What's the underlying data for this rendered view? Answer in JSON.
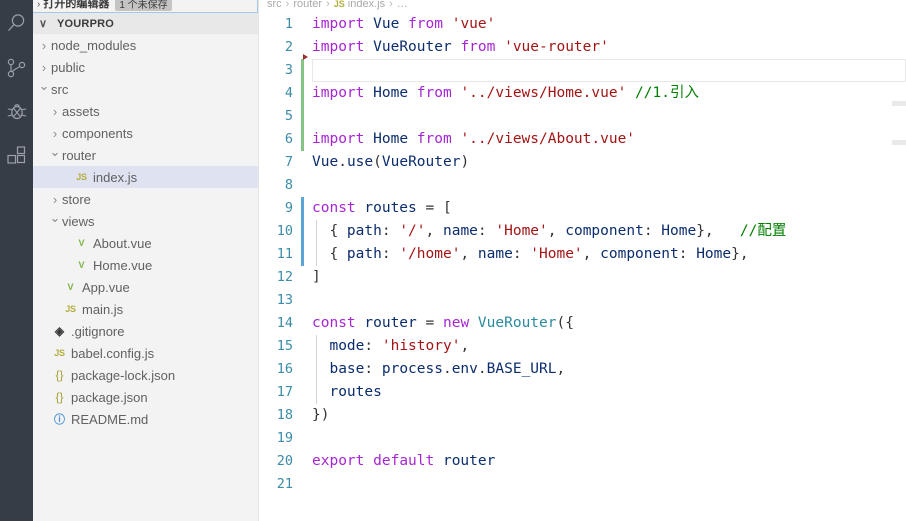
{
  "activity_bar": {
    "items": [
      {
        "name": "search-icon",
        "label": "Search"
      },
      {
        "name": "source-control-icon",
        "label": "Source Control"
      },
      {
        "name": "debug-icon",
        "label": "Run and Debug"
      },
      {
        "name": "extensions-icon",
        "label": "Extensions"
      }
    ]
  },
  "sidebar": {
    "open_editors": {
      "label": "打开的编辑器",
      "badge": "1 个未保存",
      "chevron": "›"
    },
    "folder": {
      "label": "YOURPRO",
      "chevron": "∨"
    },
    "tree": [
      {
        "label": "node_modules",
        "indent": 1,
        "type": "folder",
        "state": "collapsed",
        "icon": "chevron-right-icon",
        "selected": false
      },
      {
        "label": "public",
        "indent": 1,
        "type": "folder",
        "state": "collapsed",
        "icon": "chevron-right-icon",
        "selected": false
      },
      {
        "label": "src",
        "indent": 1,
        "type": "folder",
        "state": "expanded",
        "icon": "chevron-down-icon",
        "selected": false
      },
      {
        "label": "assets",
        "indent": 2,
        "type": "folder",
        "state": "collapsed",
        "icon": "chevron-right-icon",
        "selected": false
      },
      {
        "label": "components",
        "indent": 2,
        "type": "folder",
        "state": "collapsed",
        "icon": "chevron-right-icon",
        "selected": false
      },
      {
        "label": "router",
        "indent": 2,
        "type": "folder",
        "state": "expanded",
        "icon": "chevron-down-icon",
        "selected": false
      },
      {
        "label": "index.js",
        "indent": 3,
        "type": "file",
        "icon": "js-file-icon",
        "badge": "JS",
        "selected": true
      },
      {
        "label": "store",
        "indent": 2,
        "type": "folder",
        "state": "collapsed",
        "icon": "chevron-right-icon",
        "selected": false
      },
      {
        "label": "views",
        "indent": 2,
        "type": "folder",
        "state": "expanded",
        "icon": "chevron-down-icon",
        "selected": false
      },
      {
        "label": "About.vue",
        "indent": 3,
        "type": "file",
        "icon": "vue-file-icon",
        "badge": "V",
        "selected": false
      },
      {
        "label": "Home.vue",
        "indent": 3,
        "type": "file",
        "icon": "vue-file-icon",
        "badge": "V",
        "selected": false
      },
      {
        "label": "App.vue",
        "indent": 2,
        "type": "file",
        "icon": "vue-file-icon",
        "badge": "V",
        "selected": false
      },
      {
        "label": "main.js",
        "indent": 2,
        "type": "file",
        "icon": "js-file-icon",
        "badge": "JS",
        "selected": false
      },
      {
        "label": ".gitignore",
        "indent": 1,
        "type": "file",
        "icon": "git-file-icon",
        "badge": "◈",
        "selected": false
      },
      {
        "label": "babel.config.js",
        "indent": 1,
        "type": "file",
        "icon": "js-file-icon",
        "badge": "JS",
        "selected": false
      },
      {
        "label": "package-lock.json",
        "indent": 1,
        "type": "file",
        "icon": "json-file-icon",
        "badge": "{}",
        "selected": false
      },
      {
        "label": "package.json",
        "indent": 1,
        "type": "file",
        "icon": "json-file-icon",
        "badge": "{}",
        "selected": false
      },
      {
        "label": "README.md",
        "indent": 1,
        "type": "file",
        "icon": "markdown-file-icon",
        "badge": "ⓘ",
        "selected": false
      }
    ]
  },
  "editor": {
    "breadcrumb": [
      "src",
      "router",
      "index.js",
      "…"
    ],
    "breadcrumb_file_badge": "JS",
    "active_line": 3,
    "total_lines": 21,
    "lines": [
      {
        "n": "1",
        "gutter": "",
        "indent": 0,
        "tokens": [
          {
            "t": "import",
            "c": "kw"
          },
          {
            "t": " ",
            "c": "pl"
          },
          {
            "t": "Vue",
            "c": "id"
          },
          {
            "t": " ",
            "c": "pl"
          },
          {
            "t": "from",
            "c": "kw"
          },
          {
            "t": " ",
            "c": "pl"
          },
          {
            "t": "'vue'",
            "c": "str"
          }
        ]
      },
      {
        "n": "2",
        "gutter": "",
        "indent": 0,
        "tokens": [
          {
            "t": "import",
            "c": "kw"
          },
          {
            "t": " ",
            "c": "pl"
          },
          {
            "t": "VueRouter",
            "c": "id"
          },
          {
            "t": " ",
            "c": "pl"
          },
          {
            "t": "from",
            "c": "kw"
          },
          {
            "t": " ",
            "c": "pl"
          },
          {
            "t": "'vue-router'",
            "c": "str"
          }
        ]
      },
      {
        "n": "3",
        "gutter": "green",
        "indent": 0,
        "current": true,
        "tokens": []
      },
      {
        "n": "4",
        "gutter": "green",
        "indent": 0,
        "tokens": [
          {
            "t": "import",
            "c": "kw"
          },
          {
            "t": " ",
            "c": "pl"
          },
          {
            "t": "Home",
            "c": "id"
          },
          {
            "t": " ",
            "c": "pl"
          },
          {
            "t": "from",
            "c": "kw"
          },
          {
            "t": " ",
            "c": "pl"
          },
          {
            "t": "'../views/Home.vue'",
            "c": "str"
          },
          {
            "t": " ",
            "c": "pl"
          },
          {
            "t": "//1.引入",
            "c": "cmt"
          }
        ]
      },
      {
        "n": "5",
        "gutter": "green",
        "indent": 0,
        "tokens": []
      },
      {
        "n": "6",
        "gutter": "green",
        "indent": 0,
        "tokens": [
          {
            "t": "import",
            "c": "kw"
          },
          {
            "t": " ",
            "c": "pl"
          },
          {
            "t": "Home",
            "c": "id"
          },
          {
            "t": " ",
            "c": "pl"
          },
          {
            "t": "from",
            "c": "kw"
          },
          {
            "t": " ",
            "c": "pl"
          },
          {
            "t": "'../views/About.vue'",
            "c": "str"
          }
        ]
      },
      {
        "n": "7",
        "gutter": "",
        "indent": 0,
        "tokens": [
          {
            "t": "Vue",
            "c": "id"
          },
          {
            "t": ".",
            "c": "pl"
          },
          {
            "t": "use",
            "c": "id"
          },
          {
            "t": "(",
            "c": "pl"
          },
          {
            "t": "VueRouter",
            "c": "id"
          },
          {
            "t": ")",
            "c": "pl"
          }
        ]
      },
      {
        "n": "8",
        "gutter": "",
        "indent": 0,
        "tokens": []
      },
      {
        "n": "9",
        "gutter": "blue",
        "indent": 0,
        "tokens": [
          {
            "t": "const",
            "c": "kw"
          },
          {
            "t": " ",
            "c": "pl"
          },
          {
            "t": "routes",
            "c": "id"
          },
          {
            "t": " = [",
            "c": "pl"
          }
        ]
      },
      {
        "n": "10",
        "gutter": "blue",
        "indent": 1,
        "tokens": [
          {
            "t": "  { ",
            "c": "pl"
          },
          {
            "t": "path",
            "c": "id"
          },
          {
            "t": ": ",
            "c": "pl"
          },
          {
            "t": "'/'",
            "c": "str"
          },
          {
            "t": ", ",
            "c": "pl"
          },
          {
            "t": "name",
            "c": "id"
          },
          {
            "t": ": ",
            "c": "pl"
          },
          {
            "t": "'Home'",
            "c": "str"
          },
          {
            "t": ", ",
            "c": "pl"
          },
          {
            "t": "component",
            "c": "id"
          },
          {
            "t": ": ",
            "c": "pl"
          },
          {
            "t": "Home",
            "c": "id"
          },
          {
            "t": "},",
            "c": "pl"
          },
          {
            "t": "   ",
            "c": "pl"
          },
          {
            "t": "//配置",
            "c": "cmt"
          }
        ]
      },
      {
        "n": "11",
        "gutter": "blue",
        "indent": 1,
        "tokens": [
          {
            "t": "  { ",
            "c": "pl"
          },
          {
            "t": "path",
            "c": "id"
          },
          {
            "t": ": ",
            "c": "pl"
          },
          {
            "t": "'/home'",
            "c": "str"
          },
          {
            "t": ", ",
            "c": "pl"
          },
          {
            "t": "name",
            "c": "id"
          },
          {
            "t": ": ",
            "c": "pl"
          },
          {
            "t": "'Home'",
            "c": "str"
          },
          {
            "t": ", ",
            "c": "pl"
          },
          {
            "t": "component",
            "c": "id"
          },
          {
            "t": ": ",
            "c": "pl"
          },
          {
            "t": "Home",
            "c": "id"
          },
          {
            "t": "},",
            "c": "pl"
          }
        ]
      },
      {
        "n": "12",
        "gutter": "",
        "indent": 0,
        "tokens": [
          {
            "t": "]",
            "c": "pl"
          }
        ]
      },
      {
        "n": "13",
        "gutter": "",
        "indent": 0,
        "tokens": []
      },
      {
        "n": "14",
        "gutter": "",
        "indent": 0,
        "tokens": [
          {
            "t": "const",
            "c": "kw"
          },
          {
            "t": " ",
            "c": "pl"
          },
          {
            "t": "router",
            "c": "id"
          },
          {
            "t": " = ",
            "c": "pl"
          },
          {
            "t": "new",
            "c": "kw"
          },
          {
            "t": " ",
            "c": "pl"
          },
          {
            "t": "VueRouter",
            "c": "type"
          },
          {
            "t": "({",
            "c": "pl"
          }
        ]
      },
      {
        "n": "15",
        "gutter": "",
        "indent": 1,
        "tokens": [
          {
            "t": "  ",
            "c": "pl"
          },
          {
            "t": "mode",
            "c": "id"
          },
          {
            "t": ": ",
            "c": "pl"
          },
          {
            "t": "'history'",
            "c": "str"
          },
          {
            "t": ",",
            "c": "pl"
          }
        ]
      },
      {
        "n": "16",
        "gutter": "",
        "indent": 1,
        "tokens": [
          {
            "t": "  ",
            "c": "pl"
          },
          {
            "t": "base",
            "c": "id"
          },
          {
            "t": ": ",
            "c": "pl"
          },
          {
            "t": "process",
            "c": "id"
          },
          {
            "t": ".",
            "c": "pl"
          },
          {
            "t": "env",
            "c": "id"
          },
          {
            "t": ".",
            "c": "pl"
          },
          {
            "t": "BASE_URL",
            "c": "id"
          },
          {
            "t": ",",
            "c": "pl"
          }
        ]
      },
      {
        "n": "17",
        "gutter": "",
        "indent": 1,
        "tokens": [
          {
            "t": "  ",
            "c": "pl"
          },
          {
            "t": "routes",
            "c": "id"
          }
        ]
      },
      {
        "n": "18",
        "gutter": "",
        "indent": 0,
        "tokens": [
          {
            "t": "})",
            "c": "pl"
          }
        ]
      },
      {
        "n": "19",
        "gutter": "",
        "indent": 0,
        "tokens": []
      },
      {
        "n": "20",
        "gutter": "",
        "indent": 0,
        "tokens": [
          {
            "t": "export",
            "c": "kw"
          },
          {
            "t": " ",
            "c": "pl"
          },
          {
            "t": "default",
            "c": "kw"
          },
          {
            "t": " ",
            "c": "pl"
          },
          {
            "t": "router",
            "c": "id"
          }
        ]
      },
      {
        "n": "21",
        "gutter": "",
        "indent": 0,
        "tokens": []
      }
    ]
  },
  "colors": {
    "activity_bar_bg": "#373d46",
    "sidebar_bg": "#f3f3f3",
    "selected_row_bg": "#dfe2f1",
    "editor_bg": "#ffffff",
    "line_number": "#3b8ca8",
    "keyword": "#a626d4",
    "string": "#a31515",
    "comment": "#008000",
    "identifier": "#0b2d6e",
    "gutter_added": "#84c285",
    "gutter_modified": "#5aa4d6"
  }
}
